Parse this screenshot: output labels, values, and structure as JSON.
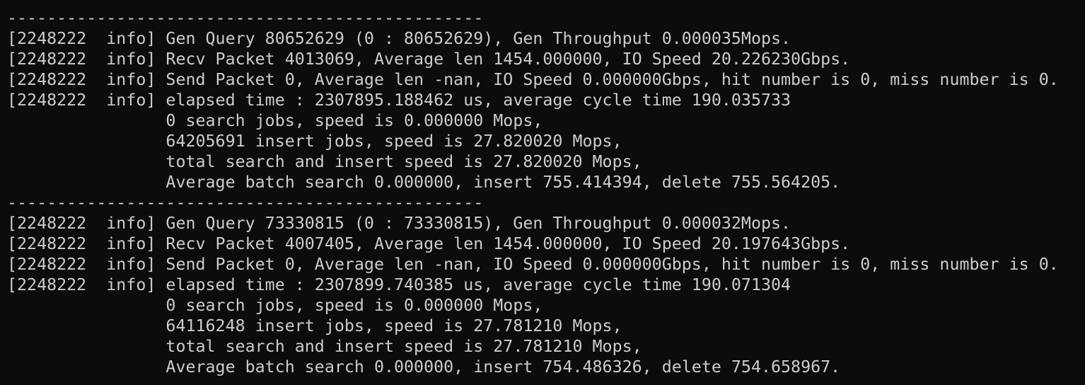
{
  "terminal": {
    "top_partial_line": "------------------------------------------------",
    "lines": [
      "------------------------------------------------",
      "[2248222  info] Gen Query 80652629 (0 : 80652629), Gen Throughput 0.000035Mops.",
      "[2248222  info] Recv Packet 4013069, Average len 1454.000000, IO Speed 20.226230Gbps.",
      "[2248222  info] Send Packet 0, Average len -nan, IO Speed 0.000000Gbps, hit number is 0, miss number is 0.",
      "[2248222  info] elapsed time : 2307895.188462 us, average cycle time 190.035733",
      "                0 search jobs, speed is 0.000000 Mops,",
      "                64205691 insert jobs, speed is 27.820020 Mops,",
      "                total search and insert speed is 27.820020 Mops,",
      "                Average batch search 0.000000, insert 755.414394, delete 755.564205.",
      "------------------------------------------------",
      "[2248222  info] Gen Query 73330815 (0 : 73330815), Gen Throughput 0.000032Mops.",
      "[2248222  info] Recv Packet 4007405, Average len 1454.000000, IO Speed 20.197643Gbps.",
      "[2248222  info] Send Packet 0, Average len -nan, IO Speed 0.000000Gbps, hit number is 0, miss number is 0.",
      "[2248222  info] elapsed time : 2307899.740385 us, average cycle time 190.071304",
      "                0 search jobs, speed is 0.000000 Mops,",
      "                64116248 insert jobs, speed is 27.781210 Mops,",
      "                total search and insert speed is 27.781210 Mops,",
      "                Average batch search 0.000000, insert 754.486326, delete 754.658967."
    ]
  },
  "colors": {
    "background": "#0c0c0c",
    "foreground": "#cccccc"
  }
}
